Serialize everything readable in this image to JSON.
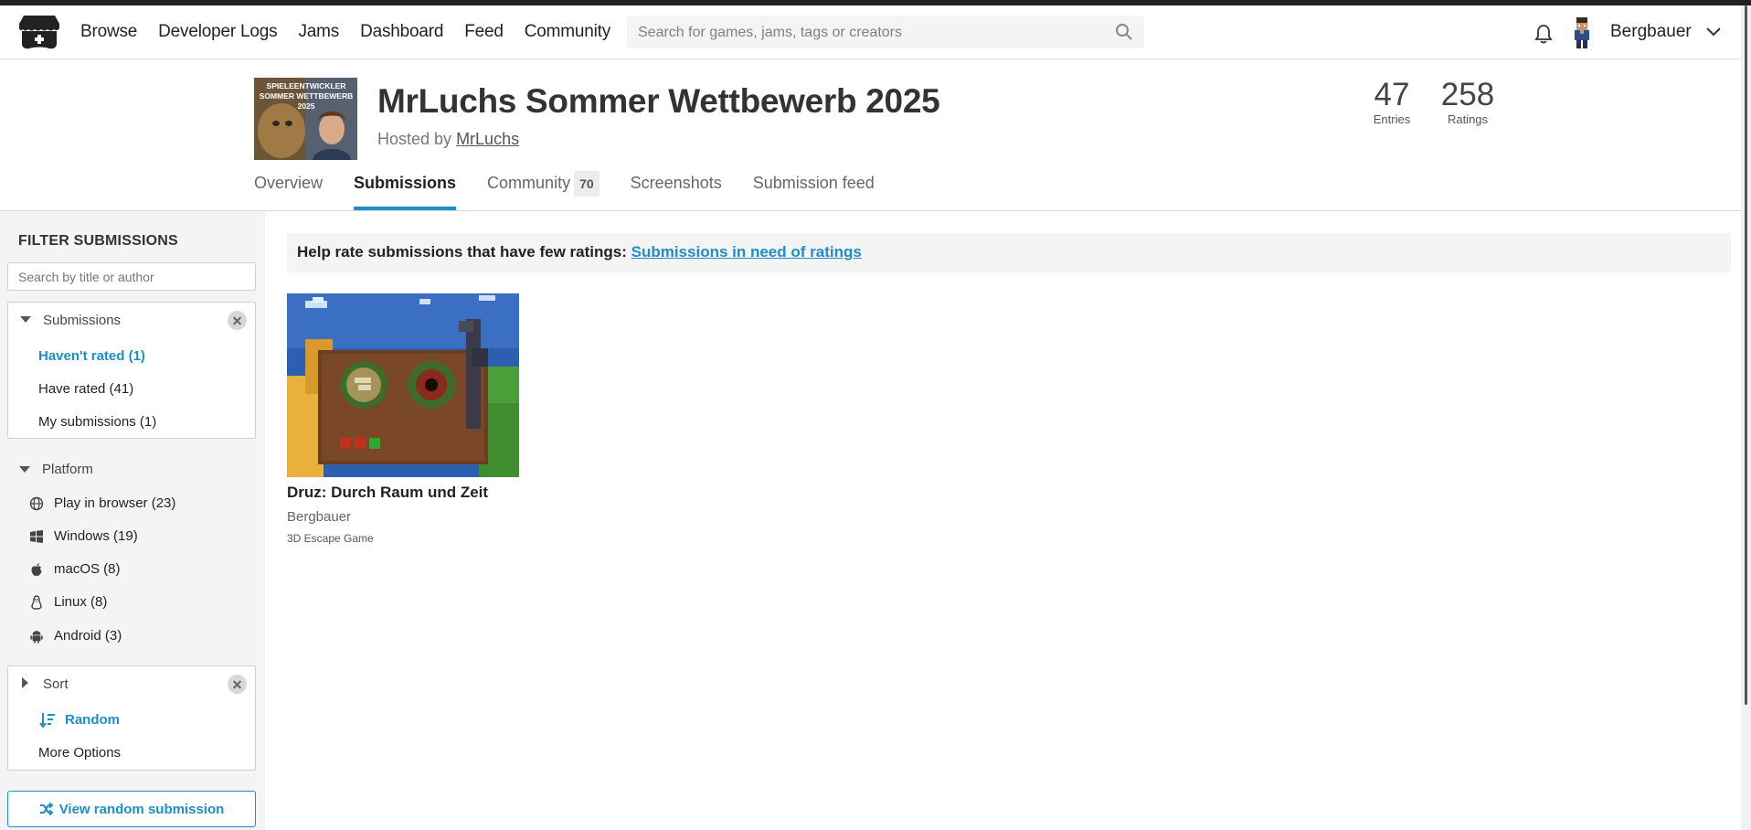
{
  "header": {
    "nav": [
      "Browse",
      "Developer Logs",
      "Jams",
      "Dashboard",
      "Feed",
      "Community"
    ],
    "search_placeholder": "Search for games, jams, tags or creators",
    "username": "Bergbauer"
  },
  "jam": {
    "cover_text": "SPIELEENTWICKLER\nSOMMER WETTBEWERB\n2025",
    "title": "MrLuchs Sommer Wettbewerb 2025",
    "hosted_prefix": "Hosted by",
    "host": "MrLuchs",
    "entries_count": "47",
    "entries_label": "Entries",
    "ratings_count": "258",
    "ratings_label": "Ratings"
  },
  "tabs": [
    {
      "label": "Overview"
    },
    {
      "label": "Submissions",
      "active": true
    },
    {
      "label": "Community",
      "badge": "70"
    },
    {
      "label": "Screenshots"
    },
    {
      "label": "Submission feed"
    }
  ],
  "sidebar": {
    "title": "FILTER SUBMISSIONS",
    "search_placeholder": "Search by title or author",
    "submissions_title": "Submissions",
    "submission_filters": [
      "Haven't rated (1)",
      "Have rated (41)",
      "My submissions (1)"
    ],
    "platform_title": "Platform",
    "platforms": [
      {
        "label": "Play in browser (23)",
        "icon": "globe-icon"
      },
      {
        "label": "Windows (19)",
        "icon": "windows-icon"
      },
      {
        "label": "macOS (8)",
        "icon": "apple-icon"
      },
      {
        "label": "Linux (8)",
        "icon": "linux-icon"
      },
      {
        "label": "Android (3)",
        "icon": "android-icon"
      }
    ],
    "sort_title": "Sort",
    "sort_value": "Random",
    "more_options": "More Options",
    "random_button": "View random submission"
  },
  "notice": {
    "text": "Help rate submissions that have few ratings:",
    "link": "Submissions in need of ratings"
  },
  "games": [
    {
      "title": "Druz: Durch Raum und Zeit",
      "author": "Bergbauer",
      "description": "3D Escape Game"
    }
  ],
  "colors": {
    "accent": "#1f8ec6",
    "sidebar_bg": "#f4f4f4",
    "top_strip": "#222222"
  }
}
